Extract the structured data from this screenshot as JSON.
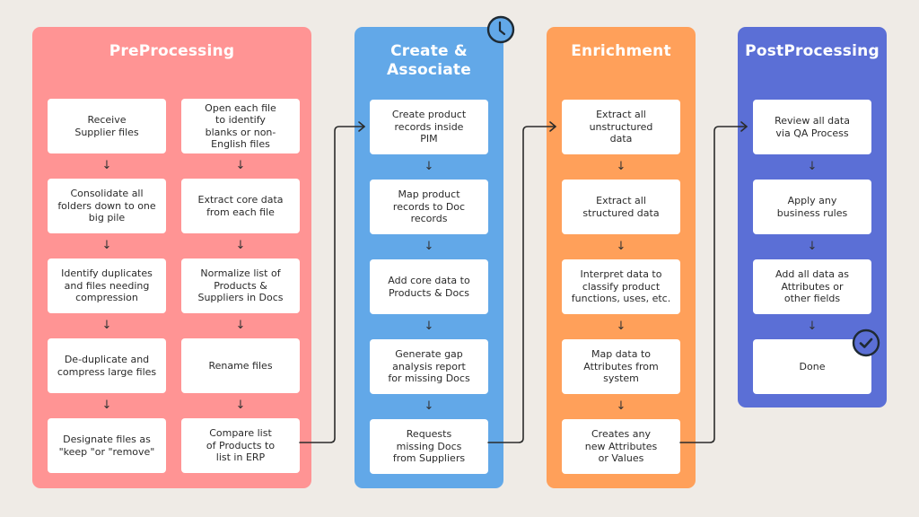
{
  "colors": {
    "background": "#efebe6",
    "preprocessing": "#ff9494",
    "create_associate": "#62a8e8",
    "enrichment": "#ffa05a",
    "postprocessing": "#5b6fd6",
    "card": "#ffffff",
    "connector": "#2b2b2b"
  },
  "arrow_glyph": "↓",
  "panels": [
    {
      "id": "preprocessing",
      "title": "PreProcessing",
      "columns": [
        {
          "steps": [
            "Receive\nSupplier files",
            "Consolidate all\nfolders down to one\nbig pile",
            "Identify duplicates\nand files needing\ncompression",
            "De-duplicate and\ncompress large files",
            "Designate files as\n\"keep \"or \"remove\""
          ]
        },
        {
          "steps": [
            "Open each file\nto identify\nblanks or non-\nEnglish files",
            "Extract core data\nfrom each file",
            "Normalize list of\nProducts &\nSuppliers in Docs",
            "Rename files",
            "Compare list\nof Products to\nlist in ERP"
          ]
        }
      ]
    },
    {
      "id": "create-associate",
      "title": "Create &\nAssociate",
      "badge_icon": "clock-icon",
      "columns": [
        {
          "steps": [
            "Create product\nrecords inside\nPIM",
            "Map product\nrecords to Doc\nrecords",
            "Add core data to\nProducts & Docs",
            "Generate gap\nanalysis report\nfor missing Docs",
            "Requests\nmissing Docs\nfrom Suppliers"
          ]
        }
      ]
    },
    {
      "id": "enrichment",
      "title": "Enrichment",
      "columns": [
        {
          "steps": [
            "Extract all\nunstructured\ndata",
            "Extract all\nstructured data",
            "Interpret data to\nclassify product\nfunctions, uses, etc.",
            "Map data to\nAttributes from\nsystem",
            "Creates any\nnew Attributes\nor Values"
          ]
        }
      ]
    },
    {
      "id": "postprocessing",
      "title": "PostProcessing",
      "badge_icon": "checkmark-icon",
      "columns": [
        {
          "steps": [
            "Review all data\nvia QA Process",
            "Apply any\nbusiness rules",
            "Add all data as\nAttributes or\nother fields",
            "Done"
          ]
        }
      ]
    }
  ]
}
